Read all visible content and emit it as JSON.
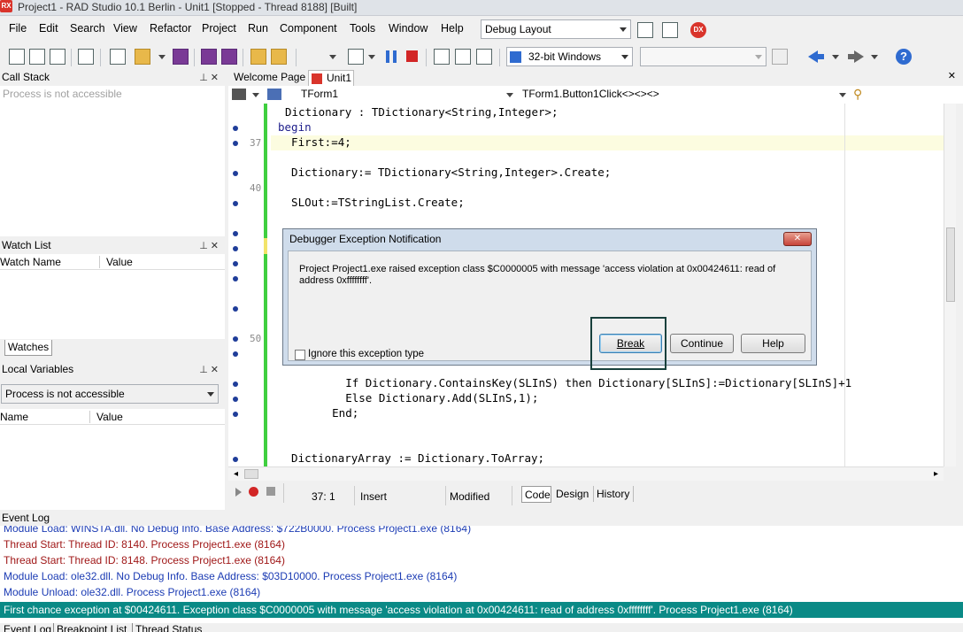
{
  "titlebar": {
    "logo": "RX",
    "title": "Project1 - RAD Studio 10.1 Berlin - Unit1 [Stopped - Thread 8188] [Built]"
  },
  "menu": {
    "items": [
      "File",
      "Edit",
      "Search",
      "View",
      "Refactor",
      "Project",
      "Run",
      "Component",
      "Tools",
      "Window",
      "Help"
    ],
    "layout_combo": "Debug Layout"
  },
  "toolbar": {
    "platform_combo": "32-bit Windows",
    "config_combo": ""
  },
  "call_stack": {
    "title": "Call Stack",
    "message": "Process is not accessible"
  },
  "watch_list": {
    "title": "Watch List",
    "columns": [
      "Watch Name",
      "Value"
    ],
    "tab": "Watches"
  },
  "local_variables": {
    "title": "Local Variables",
    "combo": "Process is not accessible",
    "columns": [
      "Name",
      "Value"
    ]
  },
  "editor_tabs": {
    "welcome": "Welcome Page",
    "unit": "Unit1"
  },
  "editor_nav": {
    "class_combo": "TForm1",
    "method_combo": "TForm1.Button1Click<><><>"
  },
  "code": {
    "line_numbers": [
      "37",
      "40",
      "50"
    ],
    "lines": [
      "Dictionary : TDictionary<String,Integer>;",
      "begin",
      "  First:=4;",
      "  Dictionary:= TDictionary<String,Integer>.Create;",
      "  SLOut:=TStringList.Create;",
      "        If Dictionary.ContainsKey(SLInS) then Dictionary[SLInS]:=Dictionary[SLInS]+1",
      "        Else Dictionary.Add(SLInS,1);",
      "      End;",
      "  DictionaryArray := Dictionary.ToArray;"
    ]
  },
  "dialog": {
    "title": "Debugger Exception Notification",
    "message": "Project Project1.exe raised exception class $C0000005 with message 'access violation at 0x00424611: read of address 0xffffffff'.",
    "ignore_label": "Ignore this exception type",
    "break_label": "Break",
    "continue_label": "Continue",
    "help_label": "Help",
    "close_glyph": "✕"
  },
  "editor_status": {
    "position": "37:  1",
    "mode": "Insert",
    "state": "Modified",
    "tabs": [
      "Code",
      "Design",
      "History"
    ]
  },
  "event_log": {
    "title": "Event Log",
    "lines": [
      {
        "text": "Module Load: WINSTA.dll. No Debug Info. Base Address: $722B0000. Process Project1.exe (8164)",
        "color": "#1c3cb4"
      },
      {
        "text": "Thread Start: Thread ID: 8140. Process Project1.exe (8164)",
        "color": "#a01818"
      },
      {
        "text": "Thread Start: Thread ID: 8148. Process Project1.exe (8164)",
        "color": "#a01818"
      },
      {
        "text": "Module Load: ole32.dll. No Debug Info. Base Address: $03D10000. Process Project1.exe (8164)",
        "color": "#1c3cb4"
      },
      {
        "text": "Module Unload: ole32.dll. Process Project1.exe (8164)",
        "color": "#1c3cb4"
      }
    ],
    "selected": "First chance exception at $00424611. Exception class $C0000005 with message 'access violation at 0x00424611: read of address 0xffffffff'. Process Project1.exe (8164)"
  },
  "bottom_tabs": [
    "Event Log",
    "Breakpoint List",
    "Thread Status"
  ]
}
